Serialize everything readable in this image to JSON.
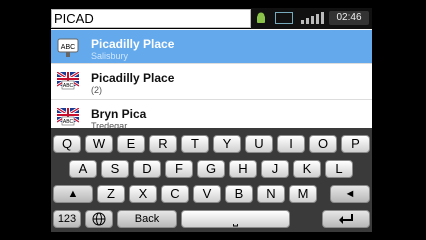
{
  "search": {
    "value": "PICAD"
  },
  "status": {
    "time": "02:46"
  },
  "results": [
    {
      "title": "Picadilly Place",
      "subtitle": "Salisbury",
      "selected": true,
      "icon": "abc-poi-icon"
    },
    {
      "title": "Picadilly Place",
      "subtitle": "(2)",
      "selected": false,
      "icon": "uk-flag-abc-icon"
    },
    {
      "title": "Bryn Pica",
      "subtitle": "Tredegar",
      "selected": false,
      "icon": "uk-flag-abc-icon"
    }
  ],
  "keyboard": {
    "row1": [
      "Q",
      "W",
      "E",
      "R",
      "T",
      "Y",
      "U",
      "I",
      "O",
      "P"
    ],
    "row2": [
      "A",
      "S",
      "D",
      "F",
      "G",
      "H",
      "J",
      "K",
      "L"
    ],
    "row3": [
      "Z",
      "X",
      "C",
      "V",
      "B",
      "N",
      "M"
    ],
    "shift_glyph": "▲",
    "left_glyph": "◄",
    "mode_label": "123",
    "back_label": "Back",
    "space_glyph": "⎵"
  },
  "colors": {
    "selected_row": "#63a9ec",
    "keyboard_bg": "#3a3a3a"
  }
}
